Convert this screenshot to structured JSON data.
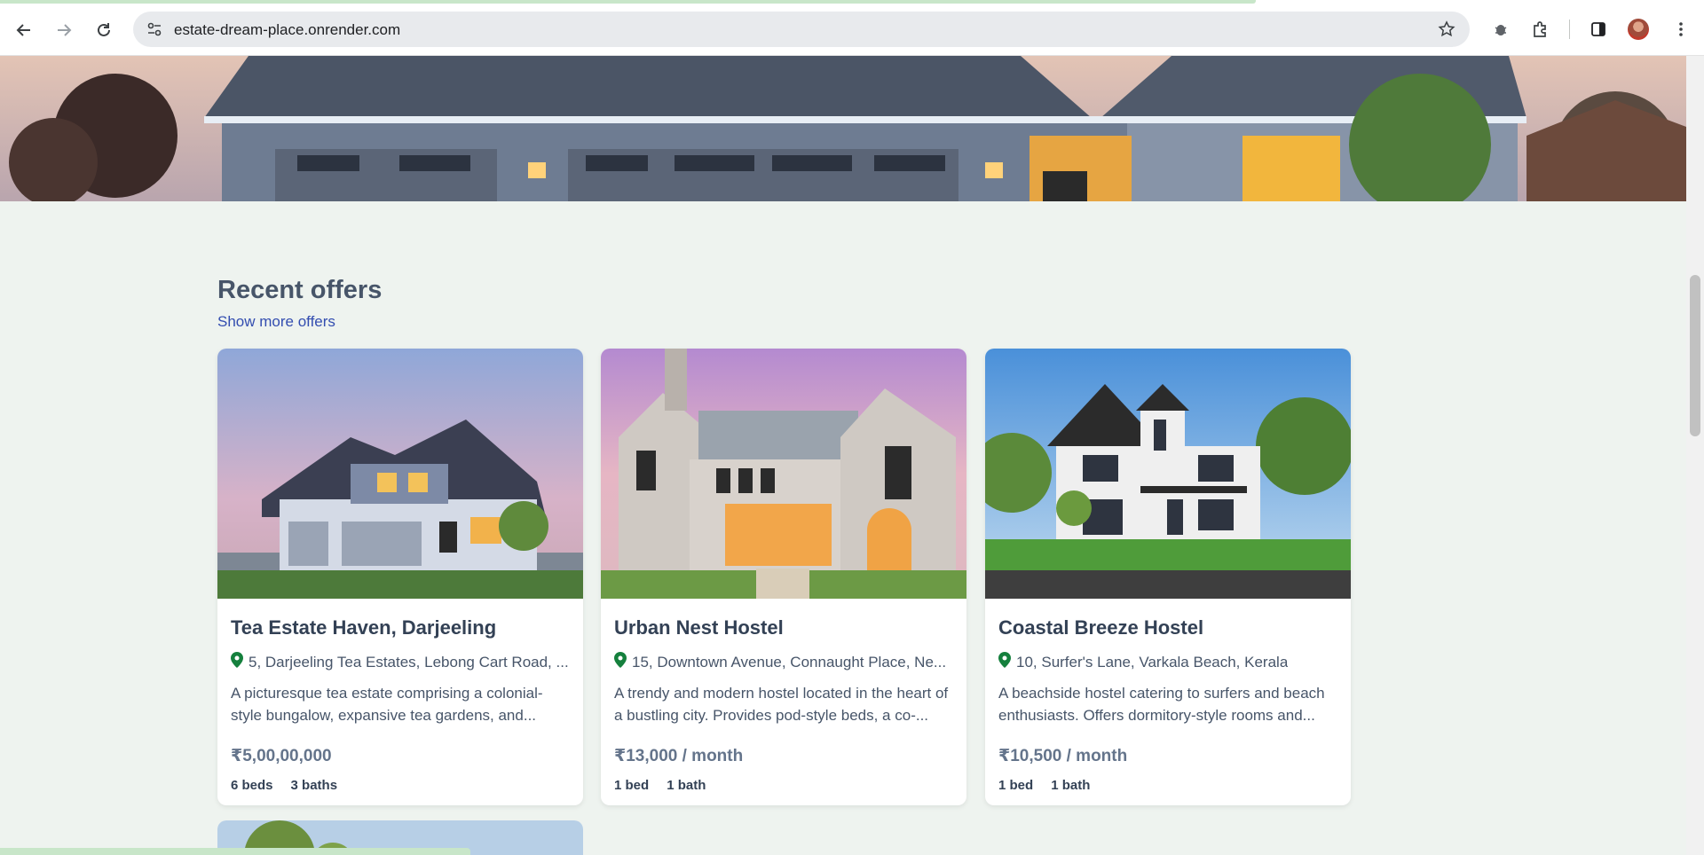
{
  "browser": {
    "url": "estate-dream-place.onrender.com",
    "icons": [
      "back-arrow-icon",
      "forward-arrow-icon",
      "reload-icon",
      "site-info-icon",
      "star-icon",
      "bug-extension-icon",
      "puzzle-icon",
      "side-panel-icon",
      "more-vert-icon"
    ]
  },
  "section": {
    "title": "Recent offers",
    "more_link": "Show more offers"
  },
  "listings": [
    {
      "title": "Tea Estate Haven, Darjeeling",
      "address": "5, Darjeeling Tea Estates, Lebong Cart Road, ...",
      "description": "A picturesque tea estate comprising a colonial-style bungalow, expansive tea gardens, and...",
      "price": "₹5,00,00,000",
      "beds": "6 beds",
      "baths": "3 baths"
    },
    {
      "title": "Urban Nest Hostel",
      "address": "15, Downtown Avenue, Connaught Place, Ne...",
      "description": "A trendy and modern hostel located in the heart of a bustling city. Provides pod-style beds, a co-...",
      "price": "₹13,000 / month",
      "beds": "1 bed",
      "baths": "1 bath"
    },
    {
      "title": "Coastal Breeze Hostel",
      "address": "10, Surfer's Lane, Varkala Beach, Kerala",
      "description": "A beachside hostel catering to surfers and beach enthusiasts. Offers dormitory-style rooms and...",
      "price": "₹10,500 / month",
      "beds": "1 bed",
      "baths": "1 bath"
    }
  ],
  "colors": {
    "page_bg": "#eef3ef",
    "link": "#334db0",
    "pin": "#15803d",
    "heading": "#475569"
  }
}
